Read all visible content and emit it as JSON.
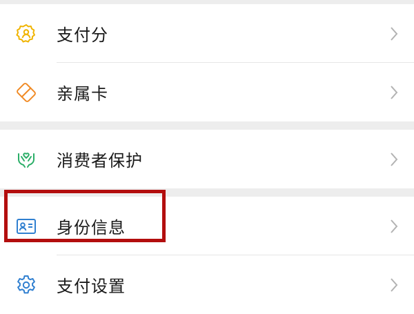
{
  "menu": {
    "items": [
      {
        "label": "支付分",
        "icon": "payscore-badge-icon",
        "icon_color": "#f0b400"
      },
      {
        "label": "亲属卡",
        "icon": "family-card-icon",
        "icon_color": "#f08a24"
      },
      {
        "label": "消费者保护",
        "icon": "protection-hands-icon",
        "icon_color": "#2aae67"
      },
      {
        "label": "身份信息",
        "icon": "id-card-icon",
        "icon_color": "#2f7fd0"
      },
      {
        "label": "支付设置",
        "icon": "gear-icon",
        "icon_color": "#2f7fd0"
      }
    ]
  },
  "colors": {
    "background": "#ededed",
    "row": "#ffffff",
    "chevron": "#b2b2b2",
    "highlight": "#b30e0e"
  }
}
